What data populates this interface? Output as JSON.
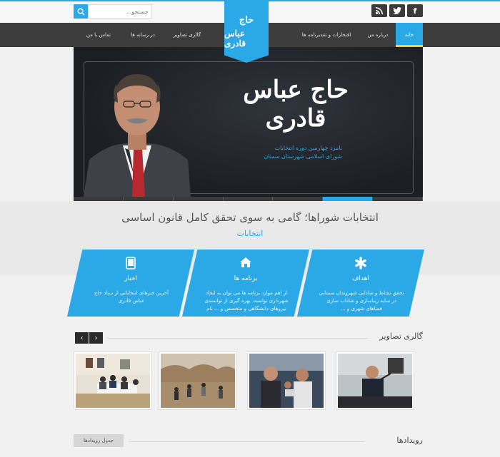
{
  "colors": {
    "accent": "#2aa9e6",
    "nav_bg": "#3c3c3c",
    "active_marker": "#ffce2e",
    "dark": "#1b1e22"
  },
  "social": [
    {
      "name": "facebook",
      "glyph": "f"
    },
    {
      "name": "twitter",
      "glyph": "t"
    },
    {
      "name": "rss",
      "glyph": "r"
    }
  ],
  "search": {
    "placeholder": "جستجو..."
  },
  "logo": {
    "line1": "حاج",
    "line2": "عباس قادری"
  },
  "nav": {
    "home": "خانه",
    "about": "درباره من",
    "honors": "افتخارات و تقدیرنامه ها",
    "gallery": "گالری تصاویر",
    "media": "در رسانه ها",
    "contact": "تماس با من"
  },
  "hero": {
    "name": "حاج عباس قادری",
    "subtitle_line1": "نامزد چهارمین دوره انتخابات",
    "subtitle_line2": "شورای اسلامی شهرستان سمنان"
  },
  "headline": {
    "title": "انتخابات شوراها؛ گامی به سوی تحقق کامل قانون اساسی",
    "category": "انتخابات"
  },
  "features": [
    {
      "title": "اهداف",
      "icon": "asterisk-icon",
      "text": "تحقق نشاط و شادابی شهروندان سمنانی در سایه زیباسازی و شاداب سازی فضاهای شهری و ..."
    },
    {
      "title": "برنامه ها",
      "icon": "home-icon",
      "text": "از اهم موارد برنامه ها می توان به ایجاد شهرداری توانمند، بهره گیری از توانمندی نیروهای دانشگاهی و متخصص و ... نام برد"
    },
    {
      "title": "اخبار",
      "icon": "tablet-icon",
      "text": "آخرین خبرهای انتخاباتی از ستاد حاج عباس قادری"
    }
  ],
  "gallery": {
    "title": "گالری تصاویر",
    "prev": "‹",
    "next": "›"
  },
  "events": {
    "title": "رویدادها",
    "button": "جدول رویدادها"
  }
}
